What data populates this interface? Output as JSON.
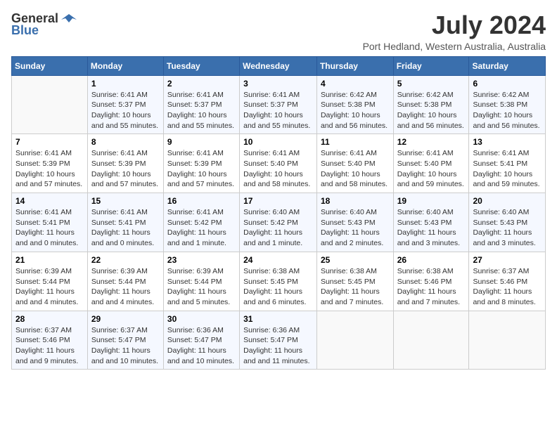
{
  "logo": {
    "general": "General",
    "blue": "Blue"
  },
  "title": "July 2024",
  "subtitle": "Port Hedland, Western Australia, Australia",
  "weekdays": [
    "Sunday",
    "Monday",
    "Tuesday",
    "Wednesday",
    "Thursday",
    "Friday",
    "Saturday"
  ],
  "weeks": [
    [
      {
        "day": "",
        "sunrise": "",
        "sunset": "",
        "daylight": ""
      },
      {
        "day": "1",
        "sunrise": "Sunrise: 6:41 AM",
        "sunset": "Sunset: 5:37 PM",
        "daylight": "Daylight: 10 hours and 55 minutes."
      },
      {
        "day": "2",
        "sunrise": "Sunrise: 6:41 AM",
        "sunset": "Sunset: 5:37 PM",
        "daylight": "Daylight: 10 hours and 55 minutes."
      },
      {
        "day": "3",
        "sunrise": "Sunrise: 6:41 AM",
        "sunset": "Sunset: 5:37 PM",
        "daylight": "Daylight: 10 hours and 55 minutes."
      },
      {
        "day": "4",
        "sunrise": "Sunrise: 6:42 AM",
        "sunset": "Sunset: 5:38 PM",
        "daylight": "Daylight: 10 hours and 56 minutes."
      },
      {
        "day": "5",
        "sunrise": "Sunrise: 6:42 AM",
        "sunset": "Sunset: 5:38 PM",
        "daylight": "Daylight: 10 hours and 56 minutes."
      },
      {
        "day": "6",
        "sunrise": "Sunrise: 6:42 AM",
        "sunset": "Sunset: 5:38 PM",
        "daylight": "Daylight: 10 hours and 56 minutes."
      }
    ],
    [
      {
        "day": "7",
        "sunrise": "Sunrise: 6:41 AM",
        "sunset": "Sunset: 5:39 PM",
        "daylight": "Daylight: 10 hours and 57 minutes."
      },
      {
        "day": "8",
        "sunrise": "Sunrise: 6:41 AM",
        "sunset": "Sunset: 5:39 PM",
        "daylight": "Daylight: 10 hours and 57 minutes."
      },
      {
        "day": "9",
        "sunrise": "Sunrise: 6:41 AM",
        "sunset": "Sunset: 5:39 PM",
        "daylight": "Daylight: 10 hours and 57 minutes."
      },
      {
        "day": "10",
        "sunrise": "Sunrise: 6:41 AM",
        "sunset": "Sunset: 5:40 PM",
        "daylight": "Daylight: 10 hours and 58 minutes."
      },
      {
        "day": "11",
        "sunrise": "Sunrise: 6:41 AM",
        "sunset": "Sunset: 5:40 PM",
        "daylight": "Daylight: 10 hours and 58 minutes."
      },
      {
        "day": "12",
        "sunrise": "Sunrise: 6:41 AM",
        "sunset": "Sunset: 5:40 PM",
        "daylight": "Daylight: 10 hours and 59 minutes."
      },
      {
        "day": "13",
        "sunrise": "Sunrise: 6:41 AM",
        "sunset": "Sunset: 5:41 PM",
        "daylight": "Daylight: 10 hours and 59 minutes."
      }
    ],
    [
      {
        "day": "14",
        "sunrise": "Sunrise: 6:41 AM",
        "sunset": "Sunset: 5:41 PM",
        "daylight": "Daylight: 11 hours and 0 minutes."
      },
      {
        "day": "15",
        "sunrise": "Sunrise: 6:41 AM",
        "sunset": "Sunset: 5:41 PM",
        "daylight": "Daylight: 11 hours and 0 minutes."
      },
      {
        "day": "16",
        "sunrise": "Sunrise: 6:41 AM",
        "sunset": "Sunset: 5:42 PM",
        "daylight": "Daylight: 11 hours and 1 minute."
      },
      {
        "day": "17",
        "sunrise": "Sunrise: 6:40 AM",
        "sunset": "Sunset: 5:42 PM",
        "daylight": "Daylight: 11 hours and 1 minute."
      },
      {
        "day": "18",
        "sunrise": "Sunrise: 6:40 AM",
        "sunset": "Sunset: 5:43 PM",
        "daylight": "Daylight: 11 hours and 2 minutes."
      },
      {
        "day": "19",
        "sunrise": "Sunrise: 6:40 AM",
        "sunset": "Sunset: 5:43 PM",
        "daylight": "Daylight: 11 hours and 3 minutes."
      },
      {
        "day": "20",
        "sunrise": "Sunrise: 6:40 AM",
        "sunset": "Sunset: 5:43 PM",
        "daylight": "Daylight: 11 hours and 3 minutes."
      }
    ],
    [
      {
        "day": "21",
        "sunrise": "Sunrise: 6:39 AM",
        "sunset": "Sunset: 5:44 PM",
        "daylight": "Daylight: 11 hours and 4 minutes."
      },
      {
        "day": "22",
        "sunrise": "Sunrise: 6:39 AM",
        "sunset": "Sunset: 5:44 PM",
        "daylight": "Daylight: 11 hours and 4 minutes."
      },
      {
        "day": "23",
        "sunrise": "Sunrise: 6:39 AM",
        "sunset": "Sunset: 5:44 PM",
        "daylight": "Daylight: 11 hours and 5 minutes."
      },
      {
        "day": "24",
        "sunrise": "Sunrise: 6:38 AM",
        "sunset": "Sunset: 5:45 PM",
        "daylight": "Daylight: 11 hours and 6 minutes."
      },
      {
        "day": "25",
        "sunrise": "Sunrise: 6:38 AM",
        "sunset": "Sunset: 5:45 PM",
        "daylight": "Daylight: 11 hours and 7 minutes."
      },
      {
        "day": "26",
        "sunrise": "Sunrise: 6:38 AM",
        "sunset": "Sunset: 5:46 PM",
        "daylight": "Daylight: 11 hours and 7 minutes."
      },
      {
        "day": "27",
        "sunrise": "Sunrise: 6:37 AM",
        "sunset": "Sunset: 5:46 PM",
        "daylight": "Daylight: 11 hours and 8 minutes."
      }
    ],
    [
      {
        "day": "28",
        "sunrise": "Sunrise: 6:37 AM",
        "sunset": "Sunset: 5:46 PM",
        "daylight": "Daylight: 11 hours and 9 minutes."
      },
      {
        "day": "29",
        "sunrise": "Sunrise: 6:37 AM",
        "sunset": "Sunset: 5:47 PM",
        "daylight": "Daylight: 11 hours and 10 minutes."
      },
      {
        "day": "30",
        "sunrise": "Sunrise: 6:36 AM",
        "sunset": "Sunset: 5:47 PM",
        "daylight": "Daylight: 11 hours and 10 minutes."
      },
      {
        "day": "31",
        "sunrise": "Sunrise: 6:36 AM",
        "sunset": "Sunset: 5:47 PM",
        "daylight": "Daylight: 11 hours and 11 minutes."
      },
      {
        "day": "",
        "sunrise": "",
        "sunset": "",
        "daylight": ""
      },
      {
        "day": "",
        "sunrise": "",
        "sunset": "",
        "daylight": ""
      },
      {
        "day": "",
        "sunrise": "",
        "sunset": "",
        "daylight": ""
      }
    ]
  ]
}
